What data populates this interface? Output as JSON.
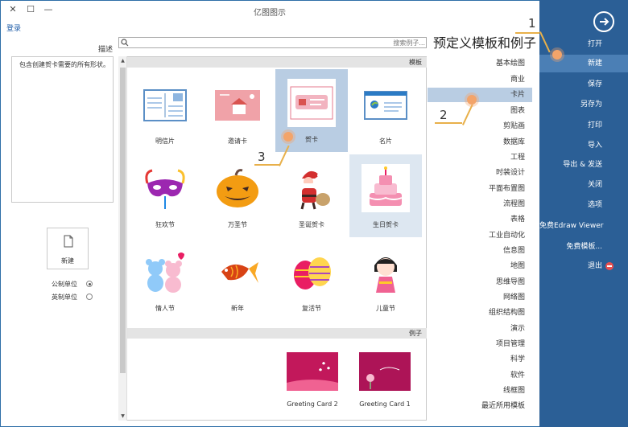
{
  "window": {
    "title": "亿图图示",
    "help_link": "登录",
    "close_glyph": "✕",
    "maximize_glyph": "☐",
    "minimize_glyph": "—"
  },
  "sidebar": {
    "back_icon": "arrow-right-circle-icon",
    "items": [
      {
        "label": "打开"
      },
      {
        "label": "新建",
        "active": true
      },
      {
        "label": "保存"
      },
      {
        "label": "另存为"
      },
      {
        "label": "打印"
      },
      {
        "label": "导入"
      },
      {
        "label": "导出 & 发送"
      },
      {
        "label": "关闭"
      },
      {
        "label": "选项"
      },
      {
        "label": "免费Edraw Viewer"
      },
      {
        "label": "免费模板..."
      },
      {
        "label": "退出"
      }
    ]
  },
  "heading": "预定义模板和例子",
  "search": {
    "placeholder": "搜索例子..."
  },
  "left_panel": {
    "desc_label": "描述",
    "desc_text": "包含创建贺卡需要的所有形状。",
    "new_label": "新建",
    "units": [
      {
        "label": "公制单位",
        "checked": true
      },
      {
        "label": "英制单位",
        "checked": false
      }
    ]
  },
  "templates_header": "模板",
  "templates": [
    {
      "label": "明信片"
    },
    {
      "label": "邀请卡"
    },
    {
      "label": "贺卡",
      "state": "selected"
    },
    {
      "label": "名片"
    },
    {
      "label": "狂欢节"
    },
    {
      "label": "万圣节"
    },
    {
      "label": "圣诞贺卡"
    },
    {
      "label": "生日贺卡",
      "state": "hover"
    },
    {
      "label": "情人节"
    },
    {
      "label": "新年"
    },
    {
      "label": "复活节"
    },
    {
      "label": "儿童节"
    }
  ],
  "examples_header": "例子",
  "examples": [
    {
      "label": "Greeting Card 2"
    },
    {
      "label": "Greeting Card 1"
    }
  ],
  "categories": [
    {
      "label": "基本绘图"
    },
    {
      "label": "商业"
    },
    {
      "label": "卡片",
      "active": true
    },
    {
      "label": "图表"
    },
    {
      "label": "剪贴画"
    },
    {
      "label": "数据库"
    },
    {
      "label": "工程"
    },
    {
      "label": "时装设计"
    },
    {
      "label": "平面布置图"
    },
    {
      "label": "流程图"
    },
    {
      "label": "表格"
    },
    {
      "label": "工业自动化"
    },
    {
      "label": "信息图"
    },
    {
      "label": "地图"
    },
    {
      "label": "思维导图"
    },
    {
      "label": "网络图"
    },
    {
      "label": "组织结构图"
    },
    {
      "label": "演示"
    },
    {
      "label": "项目管理"
    },
    {
      "label": "科学"
    },
    {
      "label": "软件"
    },
    {
      "label": "线框图"
    },
    {
      "label": "最近所用模板"
    }
  ],
  "callouts": [
    "1",
    "2",
    "3"
  ],
  "colors": {
    "sidebar": "#2b5f96",
    "sidebar_active": "#4b7fb5",
    "selection": "#b9cde3",
    "callout": "#e8b04a"
  }
}
